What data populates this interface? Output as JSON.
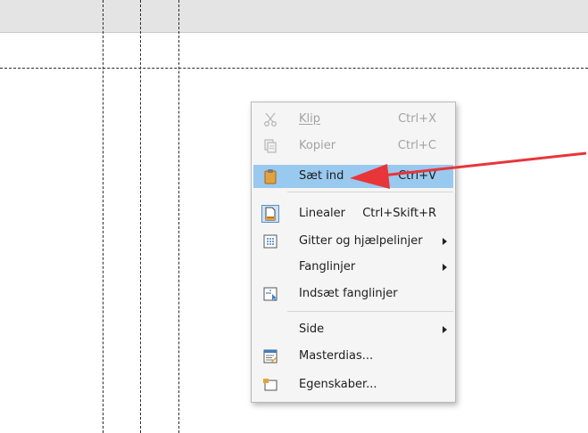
{
  "menu": {
    "items": [
      {
        "label": "Klip",
        "shortcut": "Ctrl+X",
        "icon": "scissors-icon",
        "enabled": false,
        "submenu": false
      },
      {
        "label": "Kopier",
        "shortcut": "Ctrl+C",
        "icon": "copy-icon",
        "enabled": false,
        "submenu": false
      },
      {
        "label": "Sæt ind",
        "shortcut": "Ctrl+V",
        "icon": "clipboard-icon",
        "enabled": true,
        "highlighted": true,
        "submenu": false
      },
      {
        "label": "Linealer",
        "shortcut": "Ctrl+Skift+R",
        "icon": "ruler-icon",
        "enabled": true,
        "submenu": false
      },
      {
        "label": "Gitter og hjælpelinjer",
        "shortcut": "",
        "icon": "grid-icon",
        "enabled": true,
        "submenu": true
      },
      {
        "label": "Fanglinjer",
        "shortcut": "",
        "icon": "",
        "enabled": true,
        "submenu": true
      },
      {
        "label": "Indsæt fanglinjer",
        "shortcut": "",
        "icon": "snap-point-icon",
        "enabled": true,
        "submenu": false
      },
      {
        "label": "Side",
        "shortcut": "",
        "icon": "",
        "enabled": true,
        "submenu": true
      },
      {
        "label": "Masterdias...",
        "shortcut": "",
        "icon": "master-slide-icon",
        "enabled": true,
        "submenu": false
      },
      {
        "label": "Egenskaber...",
        "shortcut": "",
        "icon": "properties-icon",
        "enabled": true,
        "submenu": false
      }
    ]
  },
  "colors": {
    "highlight": "#99c9ef",
    "annotation_arrow": "#e8353a",
    "disabled_text": "#a3a3a3"
  }
}
